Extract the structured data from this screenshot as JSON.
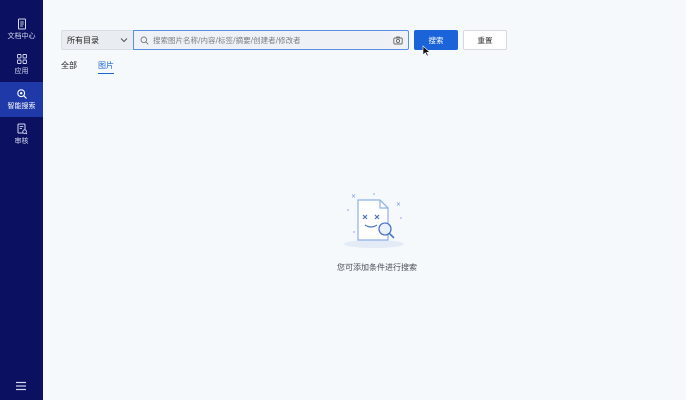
{
  "sidebar": {
    "items": [
      {
        "label": "文档中心",
        "icon": "document-icon"
      },
      {
        "label": "应用",
        "icon": "apps-grid-icon"
      },
      {
        "label": "智能搜索",
        "icon": "smart-search-icon"
      },
      {
        "label": "审核",
        "icon": "review-icon"
      }
    ],
    "active_index": 2,
    "menu_icon": "hamburger-menu-icon"
  },
  "search": {
    "scope_value": "所有目录",
    "placeholder": "搜索图片名称/内容/标签/摘要/创建者/修改者",
    "value": "",
    "search_label": "搜索",
    "reset_label": "重置"
  },
  "tabs": [
    {
      "label": "全部",
      "active": false
    },
    {
      "label": "图片",
      "active": true
    }
  ],
  "empty_state": {
    "text": "您可添加条件进行搜索",
    "icon": "empty-search-illustration"
  },
  "colors": {
    "sidebar_bg": "#0b1160",
    "sidebar_active": "#1f3aa8",
    "accent": "#1a63d9",
    "page_bg": "#f5f9fb"
  }
}
